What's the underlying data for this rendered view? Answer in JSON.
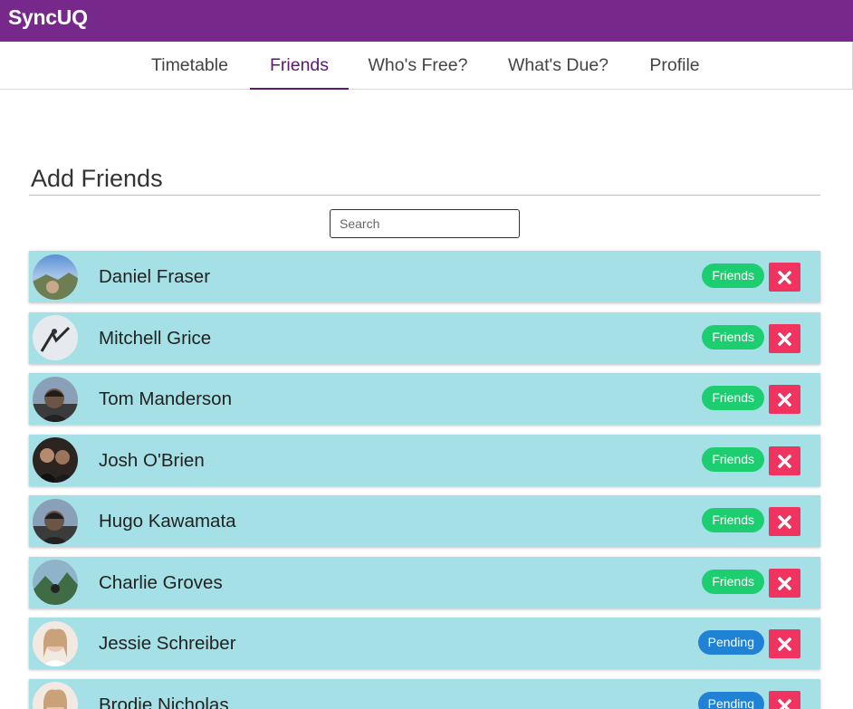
{
  "app": {
    "logo": "SyncUQ",
    "brand_color": "#76298b"
  },
  "nav": {
    "tabs": [
      {
        "label": "Timetable",
        "active": false
      },
      {
        "label": "Friends",
        "active": true
      },
      {
        "label": "Who's Free?",
        "active": false
      },
      {
        "label": "What's Due?",
        "active": false
      },
      {
        "label": "Profile",
        "active": false
      }
    ]
  },
  "main": {
    "title": "Add Friends",
    "search": {
      "placeholder": "Search",
      "value": ""
    },
    "friends": [
      {
        "name": "Daniel Fraser",
        "status": "Friends",
        "avatar": "landscape"
      },
      {
        "name": "Mitchell Grice",
        "status": "Friends",
        "avatar": "snow"
      },
      {
        "name": "Tom Manderson",
        "status": "Friends",
        "avatar": "portrait-dark"
      },
      {
        "name": "Josh O'Brien",
        "status": "Friends",
        "avatar": "portrait-group"
      },
      {
        "name": "Hugo Kawamata",
        "status": "Friends",
        "avatar": "portrait-dark"
      },
      {
        "name": "Charlie Groves",
        "status": "Friends",
        "avatar": "mountain"
      },
      {
        "name": "Jessie Schreiber",
        "status": "Pending",
        "avatar": "portrait-light"
      },
      {
        "name": "Brodie Nicholas",
        "status": "Pending",
        "avatar": "portrait-light"
      }
    ]
  },
  "colors": {
    "card": "#a4e0e6",
    "friends_badge": "#1dce70",
    "pending_badge": "#1f82d4",
    "remove_button": "#f0335f"
  },
  "icons": {
    "remove": "close-icon"
  }
}
